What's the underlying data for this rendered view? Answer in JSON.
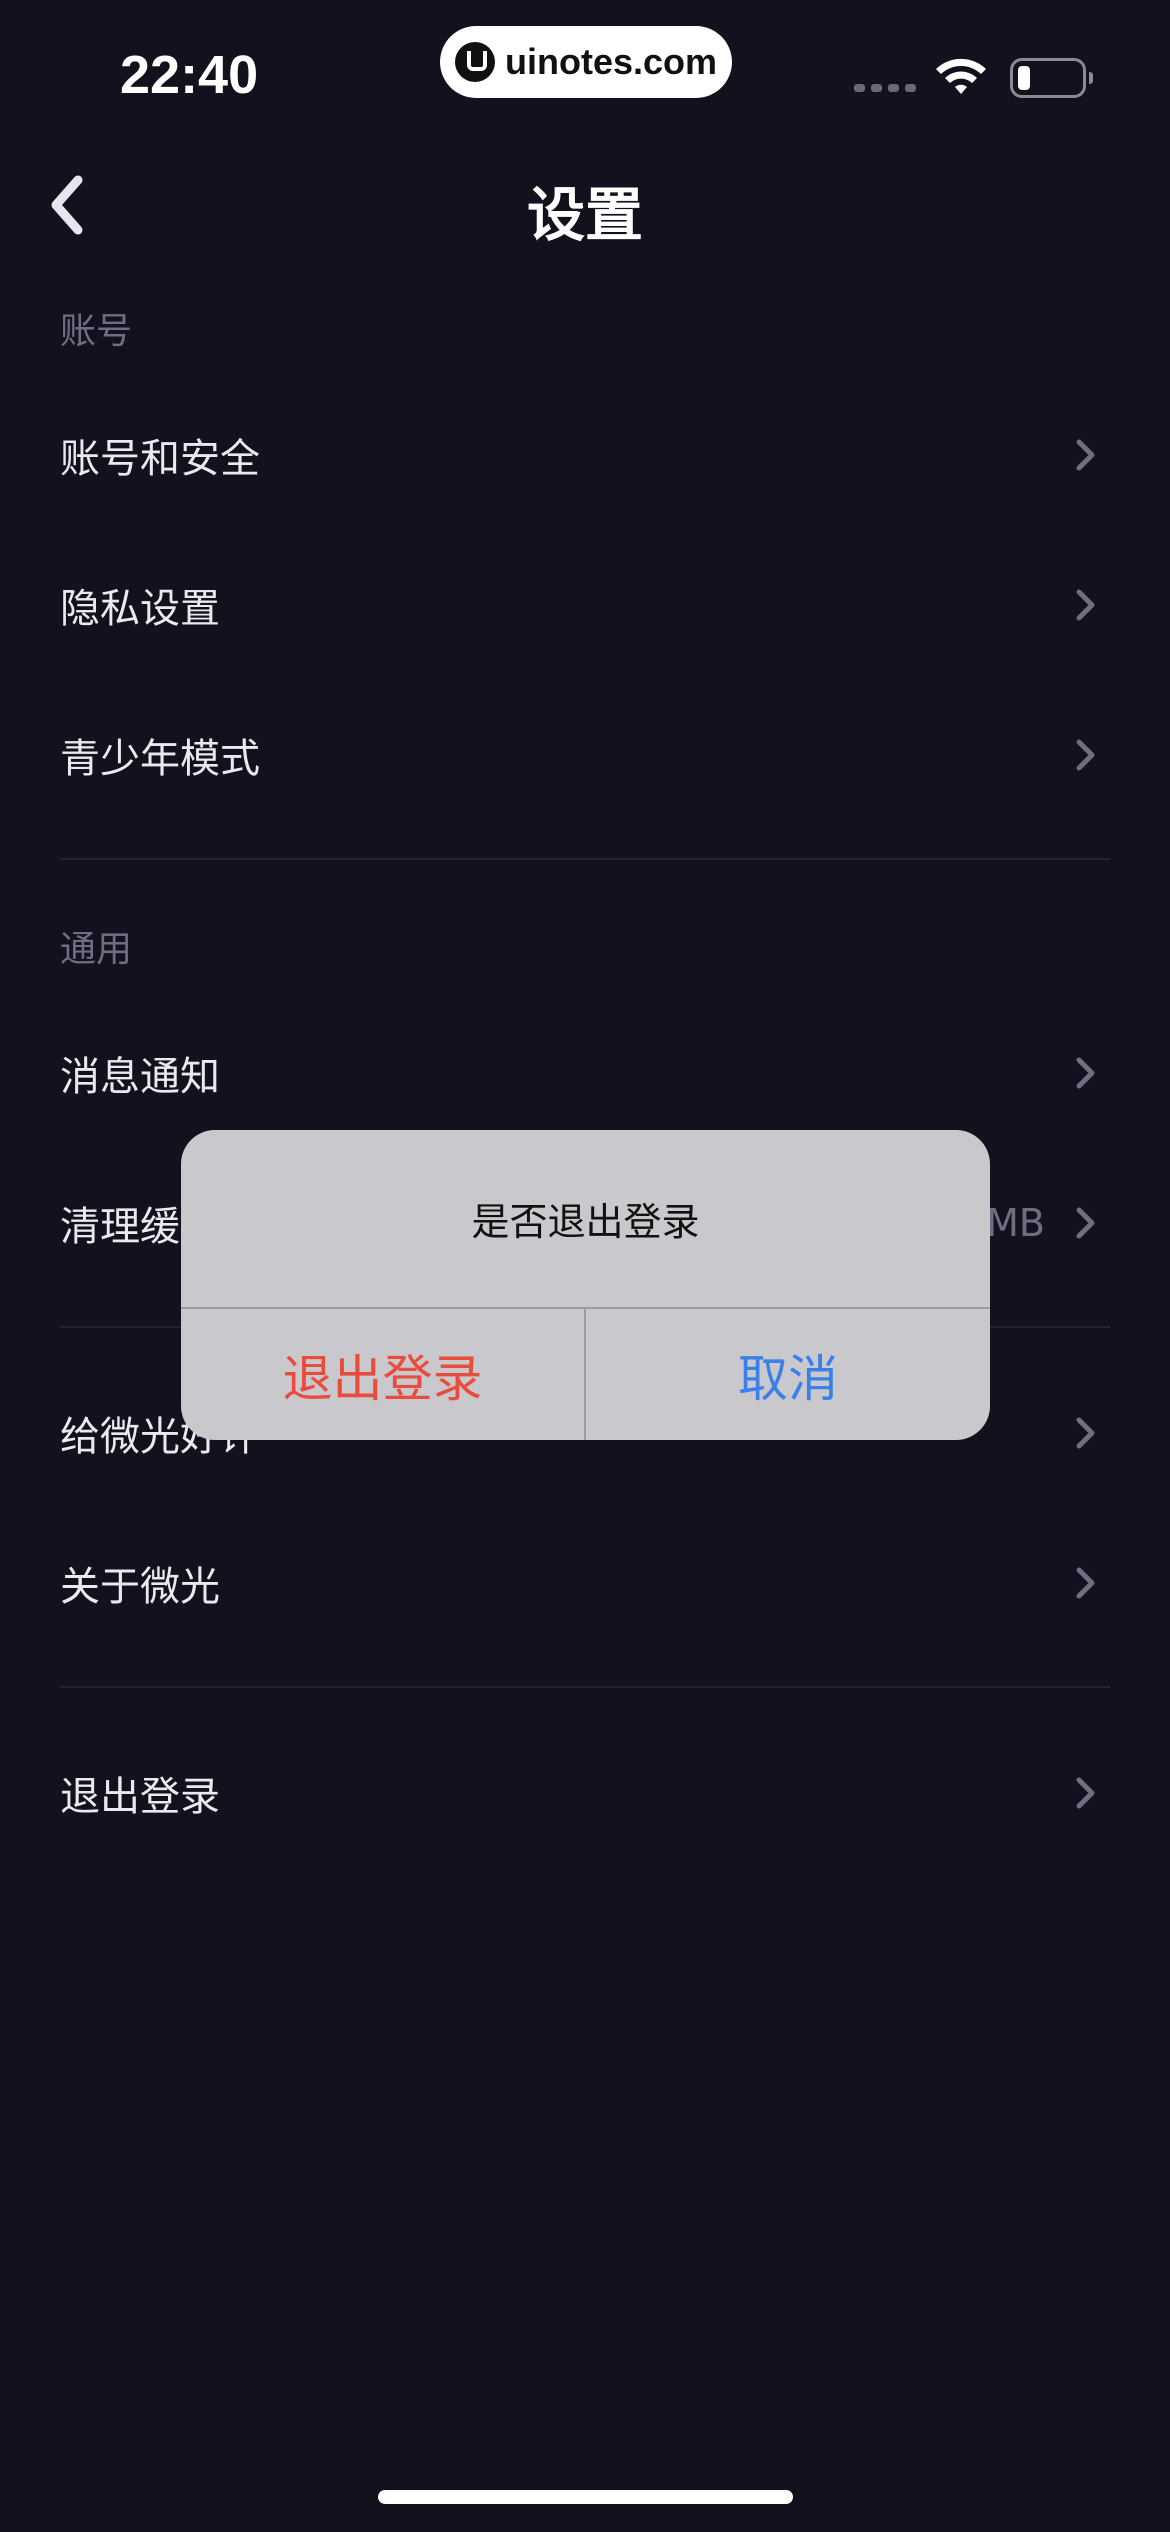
{
  "status_bar": {
    "time": "22:40",
    "watermark": "uinotes.com",
    "icons": [
      "signal-icon",
      "wifi-icon",
      "battery-icon"
    ],
    "battery_level": 0.2
  },
  "nav": {
    "back_icon": "chevron-left-icon",
    "title": "设置"
  },
  "sections": [
    {
      "header": "账号",
      "items": [
        {
          "label": "账号和安全"
        },
        {
          "label": "隐私设置"
        },
        {
          "label": "青少年模式"
        }
      ]
    },
    {
      "header": "通用",
      "items": [
        {
          "label": "消息通知"
        },
        {
          "label": "清理缓",
          "value": "MB"
        }
      ]
    },
    {
      "header": "",
      "items": [
        {
          "label": "给微光好评"
        },
        {
          "label": "关于微光"
        }
      ]
    },
    {
      "header": "",
      "items": [
        {
          "label": "退出登录"
        }
      ]
    }
  ],
  "dialog": {
    "message": "是否退出登录",
    "confirm_label": "退出登录",
    "cancel_label": "取消"
  },
  "colors": {
    "background": "#12111d",
    "confirm": "#e94c3d",
    "cancel": "#3b7fe8",
    "dialog_bg": "#c9c8cd"
  }
}
